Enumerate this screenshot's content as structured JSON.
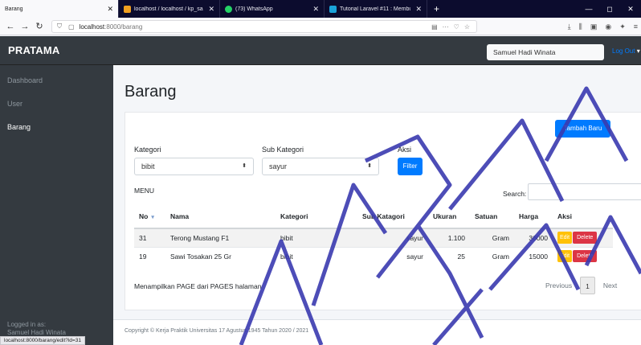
{
  "browser": {
    "tabs": [
      {
        "label": "Barang",
        "icon_color": "#ffffff"
      },
      {
        "label": "localhost / localhost / kp_sam…",
        "icon_color": "#f0a020"
      },
      {
        "label": "(73) WhatsApp",
        "icon_color": "#25d366"
      },
      {
        "label": "Tutorial Laravel #11 : Membuat…",
        "icon_color": "#1aa3d9"
      }
    ],
    "new_tab": "+",
    "url_host": "localhost",
    "url_path": ":8000/barang",
    "status_url": "localhost:8000/barang/edit?id=31"
  },
  "app": {
    "brand": "PRATAMA",
    "user_name": "Samuel Hadi Winata",
    "logout": "Log Out"
  },
  "sidebar": {
    "items": [
      {
        "label": "Dashboard"
      },
      {
        "label": "User"
      },
      {
        "label": "Barang"
      }
    ],
    "footer_label": "Logged in as:",
    "footer_user": "Samuel Hadi Winata"
  },
  "page": {
    "title": "Barang",
    "add_button": "Tambah Baru",
    "filter": {
      "kategori_label": "Kategori",
      "kategori_value": "bibit",
      "sub_kategori_label": "Sub Kategori",
      "sub_kategori_value": "sayur",
      "aksi_label": "Aksi",
      "filter_button": "Filter"
    },
    "menu_label": "MENU",
    "search_label": "Search:"
  },
  "table": {
    "headers": [
      "No",
      "Nama",
      "Kategori",
      "Sub Katagori",
      "Ukuran",
      "Satuan",
      "Harga",
      "Aksi"
    ],
    "rows": [
      {
        "no": "31",
        "nama": "Terong Mustang F1",
        "kategori": "bibit",
        "sub": "sayur",
        "ukuran": "1.100",
        "satuan": "Gram",
        "harga": "36000"
      },
      {
        "no": "19",
        "nama": "Sawi Tosakan 25 Gr",
        "kategori": "bibit",
        "sub": "sayur",
        "ukuran": "25",
        "satuan": "Gram",
        "harga": "15000"
      }
    ],
    "edit_label": "Edit",
    "delete_label": "Delete",
    "info": "Menampilkan PAGE dari PAGES halaman",
    "previous": "Previous",
    "current_page": "1",
    "next": "Next"
  },
  "footer": {
    "text": "Copyright © Kerja Praktik Universitas 17 Agustus 1945 Tahun 2020 / 2021"
  },
  "colors": {
    "primary": "#007bff",
    "warning": "#ffc107",
    "danger": "#dc3545",
    "dark": "#343a40",
    "watermark": "#3a3ab0"
  },
  "watermark_text": "PRAKTEK MATA KAYU"
}
